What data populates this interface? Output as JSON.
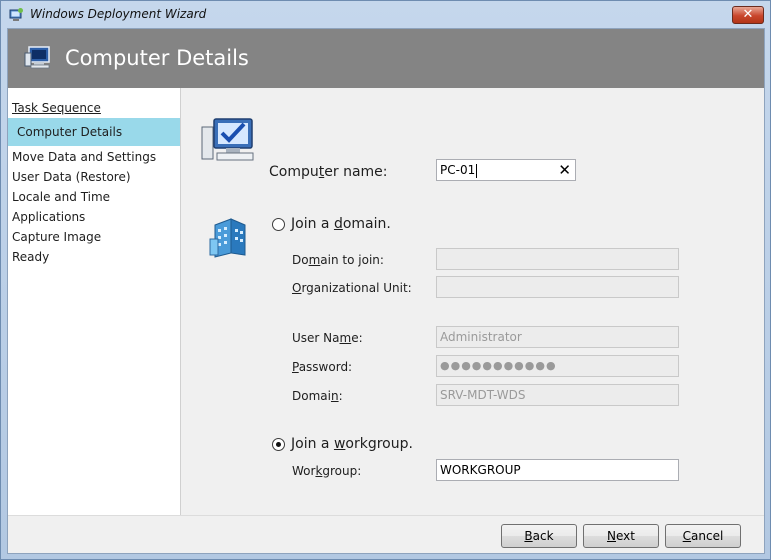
{
  "window": {
    "title": "Windows Deployment Wizard",
    "close_glyph": "✕"
  },
  "header": {
    "title": "Computer Details",
    "icon": "computer-icon"
  },
  "sidebar": {
    "items": [
      {
        "label": "Task Sequence",
        "state": "link"
      },
      {
        "label": "Computer Details",
        "state": "active"
      },
      {
        "label": "Move Data and Settings",
        "state": "normal"
      },
      {
        "label": "User Data (Restore)",
        "state": "normal"
      },
      {
        "label": "Locale and Time",
        "state": "normal"
      },
      {
        "label": "Applications",
        "state": "normal"
      },
      {
        "label": "Capture Image",
        "state": "normal"
      },
      {
        "label": "Ready",
        "state": "normal"
      }
    ]
  },
  "form": {
    "computer_name": {
      "label_pre": "Compu",
      "label_key": "t",
      "label_post": "er name:",
      "value": "PC-01",
      "clear_glyph": "✕"
    },
    "join_domain": {
      "label_pre": "Join a ",
      "label_key": "d",
      "label_post": "omain.",
      "selected": false
    },
    "domain_to_join": {
      "label_pre": "Do",
      "label_key": "m",
      "label_post": "ain to join:",
      "value": ""
    },
    "organizational_unit": {
      "label_pre": "",
      "label_key": "O",
      "label_post": "rganizational Unit:",
      "value": ""
    },
    "user_name": {
      "label_pre": "User Na",
      "label_key": "m",
      "label_post": "e:",
      "value": "Administrator"
    },
    "password": {
      "label_pre": "",
      "label_key": "P",
      "label_post": "assword:",
      "value": "●●●●●●●●●●●"
    },
    "domain": {
      "label_pre": "Domai",
      "label_key": "n",
      "label_post": ":",
      "value": "SRV-MDT-WDS"
    },
    "join_workgroup": {
      "label_pre": "Join a ",
      "label_key": "w",
      "label_post": "orkgroup.",
      "selected": true
    },
    "workgroup": {
      "label_pre": "Wor",
      "label_key": "k",
      "label_post": "group:",
      "value": "WORKGROUP"
    }
  },
  "footer": {
    "back": {
      "label_key": "B",
      "label_post": "ack"
    },
    "next": {
      "label_key": "N",
      "label_post": "ext"
    },
    "cancel": {
      "label_key": "C",
      "label_post": "ancel"
    }
  },
  "colors": {
    "header_bg": "#848484",
    "active_nav": "#99d9ea",
    "panel_bg": "#f0f0f0"
  }
}
